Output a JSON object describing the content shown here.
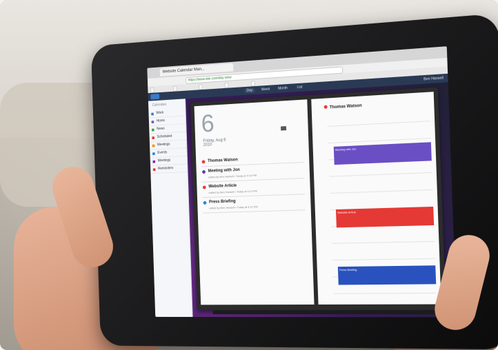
{
  "browser": {
    "tab_title": "Website Calendar Man...",
    "url": "https://www.site.com/day-view"
  },
  "app_nav": {
    "day": "Day",
    "week": "Week",
    "month": "Month",
    "list": "List",
    "user": "Ben Hansell"
  },
  "sidebar": {
    "header": "Calendars",
    "items": [
      {
        "label": "Work",
        "color": "#3d7ac7"
      },
      {
        "label": "Home",
        "color": "#7e57c2"
      },
      {
        "label": "News",
        "color": "#43a047"
      },
      {
        "label": "Scheduled",
        "color": "#e53935"
      },
      {
        "label": "Meetings",
        "color": "#fb8c00"
      },
      {
        "label": "Events",
        "color": "#1e88e5"
      },
      {
        "label": "Meetings",
        "color": "#8e24aa"
      },
      {
        "label": "Reminders",
        "color": "#e53935"
      }
    ]
  },
  "planner": {
    "day_number": "6",
    "day_label": "Friday, Aug 6",
    "year": "2010",
    "events": [
      {
        "title": "Thomas Watson",
        "color": "#e53935",
        "meta": ""
      },
      {
        "title": "Meeting with Jon",
        "color": "#5e35b1",
        "meta": "edited by Ben Hansell • Today at 4:14 PM"
      },
      {
        "title": "Website Article",
        "color": "#e53935",
        "meta": "edited by Ben Hansell • Today at 4:13 PM"
      },
      {
        "title": "Press Briefing",
        "color": "#1e88e5",
        "meta": "edited by Ben Hansell • Today at 4:12 PM"
      }
    ],
    "right_header": "Thomas Watson",
    "blocks": [
      {
        "label": "Meeting with Jon",
        "color": "#6a4fc4"
      },
      {
        "label": "Website Article",
        "color": "#e53935"
      },
      {
        "label": "Press Briefing",
        "color": "#2a52be"
      }
    ]
  }
}
